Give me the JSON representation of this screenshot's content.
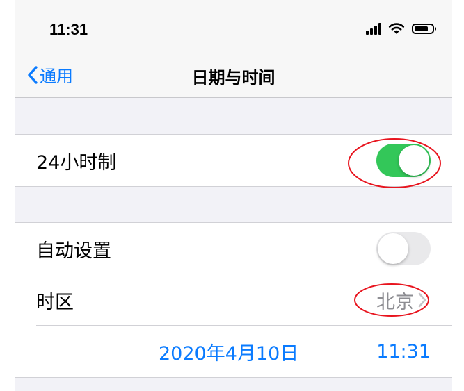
{
  "status_bar": {
    "time": "11:31"
  },
  "nav": {
    "back_label": "通用",
    "title": "日期与时间"
  },
  "settings": {
    "hour24": {
      "label": "24小时制",
      "enabled": true
    },
    "auto_set": {
      "label": "自动设置",
      "enabled": false
    },
    "timezone": {
      "label": "时区",
      "value": "北京"
    },
    "datetime": {
      "date": "2020年4月10日",
      "time": "11:31"
    }
  },
  "colors": {
    "accent": "#0a7bff",
    "toggle_on": "#33c759",
    "annotation": "#e8141e"
  },
  "icons": [
    "signal-icon",
    "wifi-icon",
    "battery-icon",
    "chevron-left-icon",
    "chevron-right-icon"
  ]
}
